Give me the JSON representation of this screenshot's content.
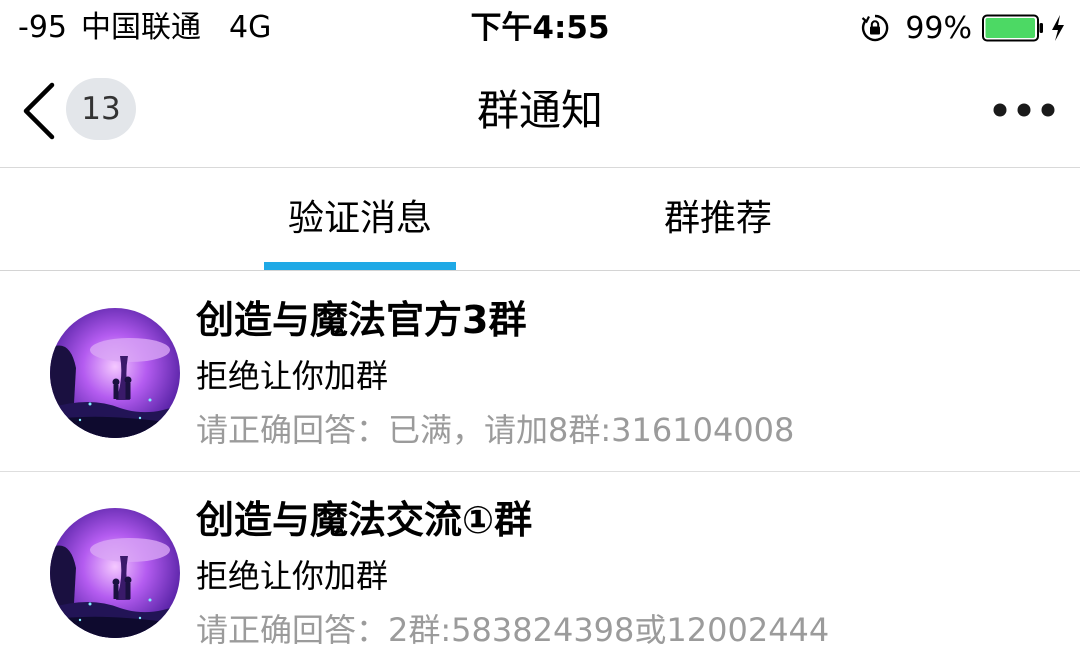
{
  "status_bar": {
    "signal": "-95",
    "carrier": "中国联通",
    "network": "4G",
    "time": "下午4:55",
    "battery_percent": "99%",
    "battery_level": 0.99,
    "battery_color": "#4cd964"
  },
  "nav": {
    "unread_count": "13",
    "title": "群通知",
    "back_icon": "chevron-left-icon",
    "more_icon": "more-dots-icon"
  },
  "tabs": [
    {
      "label": "验证消息",
      "active": true
    },
    {
      "label": "群推荐",
      "active": false
    }
  ],
  "accent_color": "#1fa9e6",
  "notifications": [
    {
      "group_name": "创造与魔法官方3群",
      "status": "拒绝让你加群",
      "answer_label": "请正确回答：",
      "answer_text": "已满，请加8群:316104008"
    },
    {
      "group_name": "创造与魔法交流①群",
      "status": "拒绝让你加群",
      "answer_label": "请正确回答：",
      "answer_text": "2群:583824398或12002444"
    }
  ]
}
